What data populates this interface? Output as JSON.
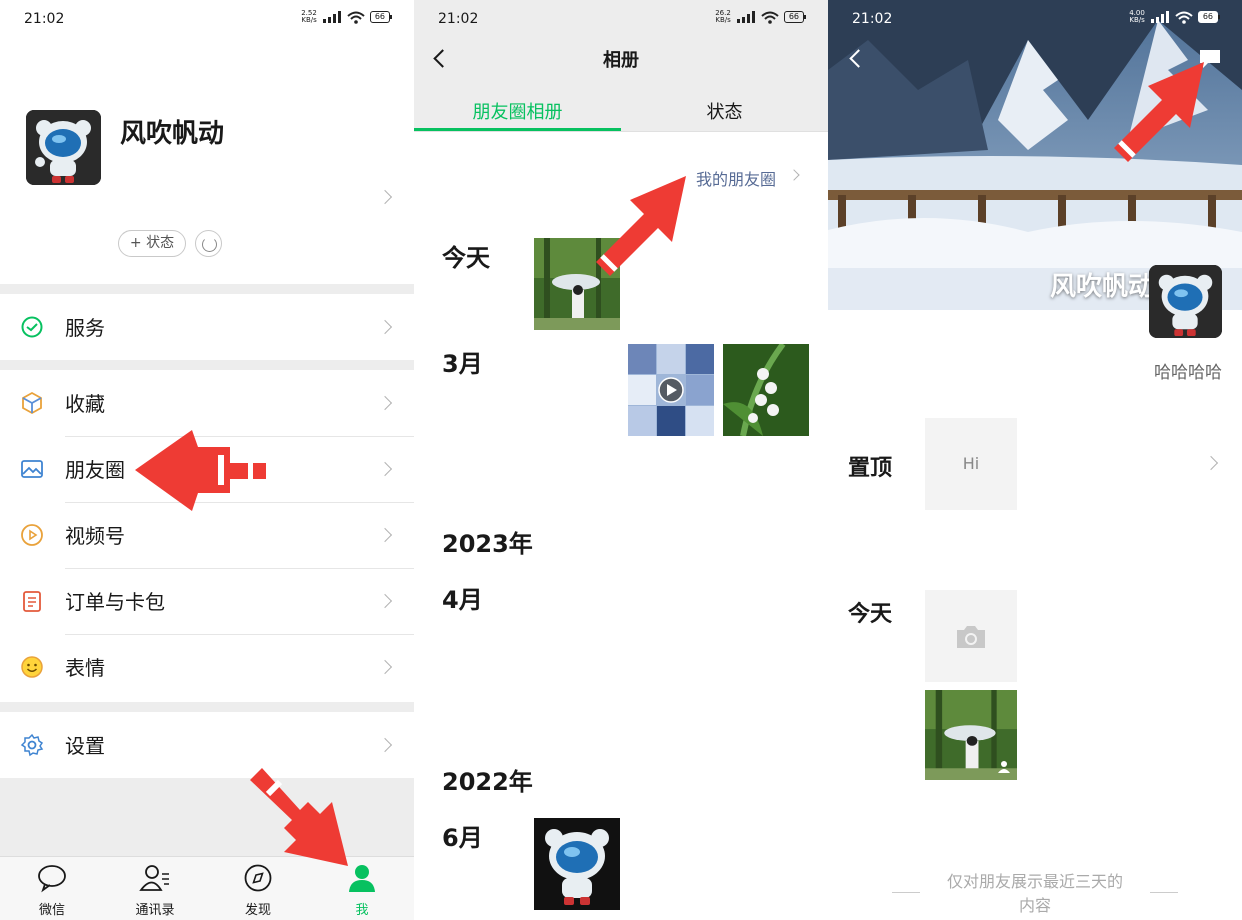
{
  "status": {
    "time": "21:02",
    "p1_speed": [
      "2.52",
      "KB/s"
    ],
    "p2_speed": [
      "26.2",
      "KB/s"
    ],
    "p3_speed": [
      "4.00",
      "KB/s"
    ],
    "battery": "66"
  },
  "profile": {
    "name": "风吹帆动",
    "status_button": "+ 状态"
  },
  "menu": {
    "service": "服务",
    "favorites": "收藏",
    "moments": "朋友圈",
    "channels": "视频号",
    "orders": "订单与卡包",
    "stickers": "表情",
    "settings": "设置"
  },
  "tabbar": {
    "chats": "微信",
    "contacts": "通讯录",
    "discover": "发现",
    "me": "我"
  },
  "album": {
    "title": "相册",
    "tab_moments": "朋友圈相册",
    "tab_status": "状态",
    "my_moments_link": "我的朋友圈",
    "sections": {
      "today": "今天",
      "march": "3月",
      "year_2023": "2023年",
      "april": "4月",
      "year_2022": "2022年",
      "june": "6月"
    }
  },
  "moments_page": {
    "name": "风吹帆动",
    "signature": "哈哈哈哈",
    "pinned_label": "置顶",
    "pinned_text": "Hi",
    "today_label": "今天",
    "footer_line1": "仅对朋友展示最近三天的",
    "footer_line2": "内容"
  },
  "colors": {
    "accent": "#07c160",
    "link": "#576b95",
    "annotation_arrow": "#ee3b34"
  }
}
